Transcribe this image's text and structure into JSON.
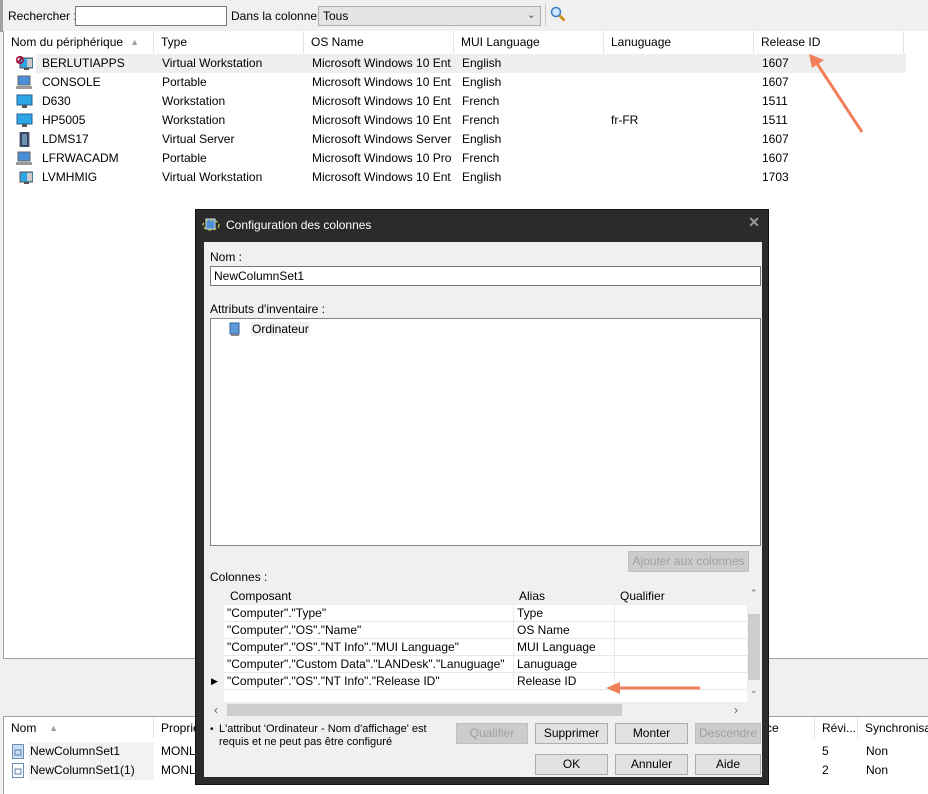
{
  "search": {
    "label": "Rechercher :",
    "value": "",
    "column_label": "Dans la colonne :",
    "column_selected": "Tous",
    "search_icon": "magnifier-icon"
  },
  "devices": {
    "columns": [
      "Nom du périphérique",
      "Type",
      "OS Name",
      "MUI Language",
      "Lanuguage",
      "Release ID"
    ],
    "sorted_column": "Nom du périphérique",
    "rows": [
      {
        "icon": "virtual-workstation-blocked-icon",
        "name": "BERLUTIAPPS",
        "type": "Virtual Workstation",
        "os": "Microsoft Windows 10 Ent...",
        "mui": "English",
        "lang": "",
        "release": "1607"
      },
      {
        "icon": "laptop-icon",
        "name": "CONSOLE",
        "type": "Portable",
        "os": "Microsoft Windows 10 Ent...",
        "mui": "English",
        "lang": "",
        "release": "1607"
      },
      {
        "icon": "monitor-icon",
        "name": "D630",
        "type": "Workstation",
        "os": "Microsoft Windows 10 Ent...",
        "mui": "French",
        "lang": "",
        "release": "1511"
      },
      {
        "icon": "monitor-icon",
        "name": "HP5005",
        "type": "Workstation",
        "os": "Microsoft Windows 10 Ent...",
        "mui": "French",
        "lang": "fr-FR",
        "release": "1511"
      },
      {
        "icon": "server-icon",
        "name": "LDMS17",
        "type": "Virtual Server",
        "os": "Microsoft Windows Server ...",
        "mui": "English",
        "lang": "",
        "release": "1607"
      },
      {
        "icon": "laptop-icon",
        "name": "LFRWACADM",
        "type": "Portable",
        "os": "Microsoft Windows 10 Prof...",
        "mui": "French",
        "lang": "",
        "release": "1607"
      },
      {
        "icon": "virtual-workstation-icon",
        "name": "LVMHMIG",
        "type": "Virtual Workstation",
        "os": "Microsoft Windows 10 Ent...",
        "mui": "English",
        "lang": "",
        "release": "1703"
      }
    ]
  },
  "column_sets": {
    "columns": [
      "Nom",
      "Propriét",
      "rce",
      "Révi...",
      "Synchronisa..."
    ],
    "rows": [
      {
        "name": "NewColumnSet1",
        "owner": "MONLA",
        "revision": "5",
        "sync": "Non"
      },
      {
        "name": "NewColumnSet1(1)",
        "owner": "MONLA",
        "revision": "2",
        "sync": "Non"
      }
    ]
  },
  "dialog": {
    "title": "Configuration des colonnes",
    "name_label": "Nom :",
    "name_value": "NewColumnSet1",
    "attributes_label": "Attributs d'inventaire :",
    "tree_root": "Ordinateur",
    "add_button": "Ajouter aux colonnes",
    "columns_label": "Colonnes :",
    "grid_headers": [
      "Composant",
      "Alias",
      "Qualifier"
    ],
    "grid_rows": [
      {
        "component": "\"Computer\".\"Type\"",
        "alias": "Type",
        "qualifier": "",
        "current": false
      },
      {
        "component": "\"Computer\".\"OS\".\"Name\"",
        "alias": "OS Name",
        "qualifier": "",
        "current": false
      },
      {
        "component": "\"Computer\".\"OS\".\"NT Info\".\"MUI Language\"",
        "alias": "MUI Language",
        "qualifier": "",
        "current": false
      },
      {
        "component": "\"Computer\".\"Custom Data\".\"LANDesk\".\"Lanuguage\"",
        "alias": "Lanuguage",
        "qualifier": "",
        "current": false
      },
      {
        "component": "\"Computer\".\"OS\".\"NT Info\".\"Release ID\"",
        "alias": "Release ID",
        "qualifier": "",
        "current": true
      }
    ],
    "note_bullet": "•",
    "note": "L'attribut 'Ordinateur - Nom d'affichage' est requis et ne peut pas être configuré",
    "buttons": {
      "qualifier": "Qualifier",
      "delete": "Supprimer",
      "up": "Monter",
      "down": "Descendre",
      "ok": "OK",
      "cancel": "Annuler",
      "help": "Aide"
    },
    "close_glyph": "✕"
  },
  "annotation_color": "#f07f5a"
}
